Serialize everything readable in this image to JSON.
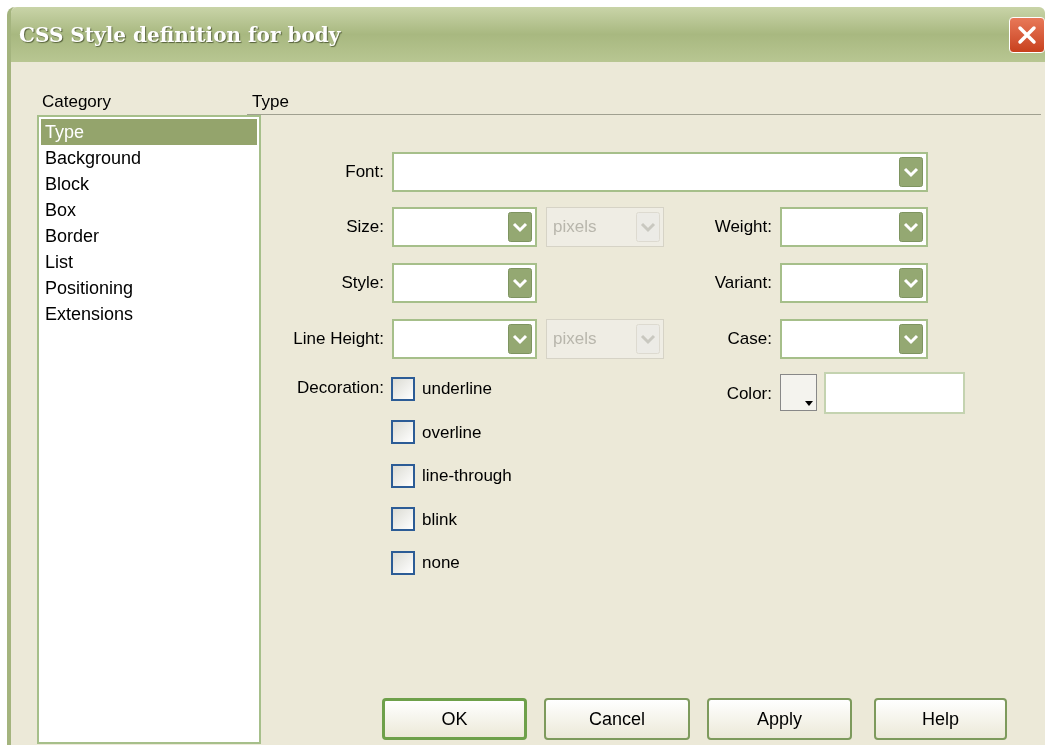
{
  "window": {
    "title": "CSS Style definition for body"
  },
  "category": {
    "label": "Category",
    "items": [
      {
        "label": "Type",
        "selected": true
      },
      {
        "label": "Background",
        "selected": false
      },
      {
        "label": "Block",
        "selected": false
      },
      {
        "label": "Box",
        "selected": false
      },
      {
        "label": "Border",
        "selected": false
      },
      {
        "label": "List",
        "selected": false
      },
      {
        "label": "Positioning",
        "selected": false
      },
      {
        "label": "Extensions",
        "selected": false
      }
    ]
  },
  "panel": {
    "heading": "Type",
    "font": {
      "label": "Font:"
    },
    "size": {
      "label": "Size:",
      "unit": {
        "value": "pixels",
        "disabled": true
      }
    },
    "weight": {
      "label": "Weight:"
    },
    "style": {
      "label": "Style:"
    },
    "variant": {
      "label": "Variant:"
    },
    "line_height": {
      "label": "Line Height:",
      "unit": {
        "value": "pixels",
        "disabled": true
      }
    },
    "case": {
      "label": "Case:"
    },
    "decoration": {
      "label": "Decoration:",
      "options": [
        {
          "label": "underline",
          "checked": false
        },
        {
          "label": "overline",
          "checked": false
        },
        {
          "label": "line-through",
          "checked": false
        },
        {
          "label": "blink",
          "checked": false
        },
        {
          "label": "none",
          "checked": false
        }
      ]
    },
    "color": {
      "label": "Color:"
    }
  },
  "buttons": [
    {
      "label": "OK",
      "default": true
    },
    {
      "label": "Cancel",
      "default": false
    },
    {
      "label": "Apply",
      "default": false
    },
    {
      "label": "Help",
      "default": false
    }
  ]
}
